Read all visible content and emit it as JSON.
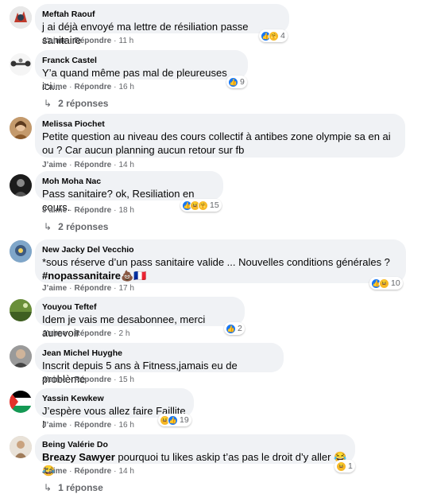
{
  "action_like": "J’aime",
  "action_reply": "Répondre",
  "comments": [
    {
      "author": "Meftah Raouf",
      "text": "j ai déjà envoyé ma lettre de résiliation passe sanitaire",
      "time": "11 h",
      "reactions": "4"
    },
    {
      "author": "Franck Castel",
      "text": "Y’a quand même pas mal de pleureuses ici...",
      "time": "16 h",
      "reactions": "9",
      "replies": "2 réponses"
    },
    {
      "author": "Melissa Piochet",
      "text": "Petite question au niveau des cours collectif à antibes zone olympie sa en ai ou ? Car aucun planning aucun retour sur fb",
      "time": "14 h"
    },
    {
      "author": "Moh Moha Nac",
      "text": "Pass sanitaire? ok, Resiliation en cours.",
      "time": "18 h",
      "reactions": "15",
      "replies": "2 réponses"
    },
    {
      "author": "New Jacky Del Vecchio",
      "text": "*sous réserve d’un pass sanitaire valide ... Nouvelles conditions générales ?",
      "hashtag": "#nopassanitaire",
      "time": "17 h",
      "reactions": "10"
    },
    {
      "author": "Youyou Teftef",
      "text": "Idem je vais me desabonnee, merci aurevoir",
      "time": "2 h",
      "reactions": "2"
    },
    {
      "author": "Jean Michel Huyghe",
      "text": "Inscrit depuis 5 ans à Fitness,jamais eu de problème",
      "time": "15 h"
    },
    {
      "author": "Yassin Kewkew",
      "text": "J’espère vous allez faire Faillite !",
      "time": "16 h",
      "reactions": "19"
    },
    {
      "author": "Being Valérie Do",
      "mention": "Breazy Sawyer",
      "text": "pourquoi tu likes askip t’as pas le droit d’y aller",
      "time": "14 h",
      "reactions": "1",
      "replies": "1 réponse"
    }
  ]
}
